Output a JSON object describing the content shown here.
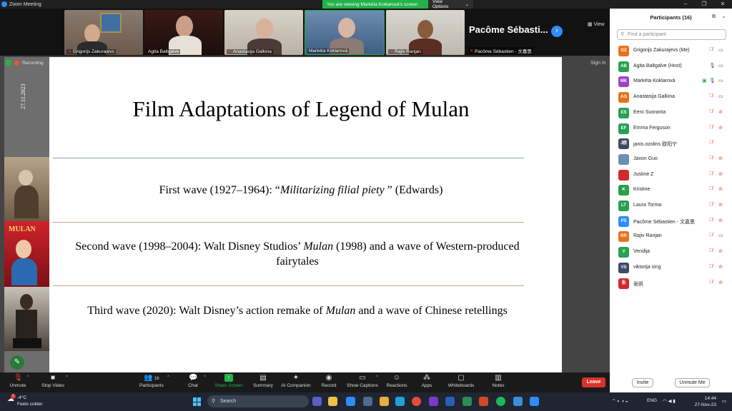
{
  "window": {
    "title": "Zoom Meeting",
    "controls": [
      "–",
      "❐",
      "✕"
    ]
  },
  "banner": {
    "viewing": "You are viewing Markéta Koklarová's screen",
    "view_options": "View Options",
    "chevron": "⌄"
  },
  "strip": {
    "tiles": [
      {
        "name": "Grigorijs Zakurajevs"
      },
      {
        "name": "Agita Baltgalve"
      },
      {
        "name": "Anastasija Galkina"
      },
      {
        "name": "Markéta Koklarová"
      },
      {
        "name": "Rajiv Ranjan"
      },
      {
        "name": "Pacôme Sébastien - 文嘉思"
      }
    ],
    "big_name": "Pacôme  Sébasti...",
    "view_label": "View",
    "next": "›"
  },
  "share": {
    "recording": "Recording",
    "sign_in": "Sign in",
    "slide": {
      "date": "27.11.2023",
      "poster_text": "MULAN",
      "title": "Film Adaptations of Legend of Mulan",
      "points": [
        {
          "pre": "First wave (1927–1964): “",
          "em": "Militarizing filial piety",
          "post": " ” (Edwards)"
        },
        {
          "pre": "Second wave (1998–2004): Walt Disney Studios’ ",
          "em": "Mulan",
          "post": " (1998) and a wave of Western-produced fairytales"
        },
        {
          "pre": "Third wave (2020): Walt Disney’s action remake of ",
          "em": "Mulan",
          "post": " and a wave of Chinese retellings"
        }
      ]
    }
  },
  "toolbar": {
    "unmute": "Unmute",
    "stop_video": "Stop Video",
    "participants": "Participants",
    "participants_count": "16",
    "chat": "Chat",
    "share_screen": "Share Screen",
    "summary": "Summary",
    "ai_companion": "AI Companion",
    "record": "Record",
    "show_captions": "Show Captions",
    "reactions": "Reactions",
    "apps": "Apps",
    "whiteboards": "Whiteboards",
    "notes": "Notes",
    "leave": "Leave"
  },
  "panel": {
    "title": "Participants (16)",
    "search_placeholder": "Find a participant",
    "participants": [
      {
        "initials": "GZ",
        "name": "Grigorijs Zakurajevs (Me)",
        "color": "#e8721c",
        "muted": true,
        "video_off": false
      },
      {
        "initials": "AB",
        "name": "Agita Baltgalve (Host)",
        "color": "#27a052",
        "muted": false,
        "video_off": false
      },
      {
        "initials": "MK",
        "name": "Markéta Koklarová",
        "color": "#9a43c6",
        "muted": false,
        "video_off": false,
        "sharing": true
      },
      {
        "initials": "AG",
        "name": "Anastasija Galkina",
        "color": "#e8721c",
        "muted": true,
        "video_off": false
      },
      {
        "initials": "ES",
        "name": "Eero Suoranta",
        "color": "#27a052",
        "muted": true,
        "video_off": true
      },
      {
        "initials": "EF",
        "name": "Emma Ferguson",
        "color": "#27a052",
        "muted": true,
        "video_off": true
      },
      {
        "initials": "J欧",
        "name": "janis.ozolins 欧阳宁",
        "color": "#3c4a63",
        "muted": true,
        "video_off": false,
        "no_video_icon": true
      },
      {
        "initials": "",
        "name": "Jaxon Guo",
        "color": "#6b8fb5",
        "muted": true,
        "video_off": true
      },
      {
        "initials": "",
        "name": "Justine Z",
        "color": "#d12a2a",
        "muted": true,
        "video_off": true
      },
      {
        "initials": "K",
        "name": "Kristine",
        "color": "#27a052",
        "muted": true,
        "video_off": true
      },
      {
        "initials": "LT",
        "name": "Laura Torma",
        "color": "#27a052",
        "muted": true,
        "video_off": true
      },
      {
        "initials": "PS",
        "name": "Pacôme Sébastien - 文嘉思",
        "color": "#2d8cff",
        "muted": true,
        "video_off": true
      },
      {
        "initials": "RR",
        "name": "Rajiv Ranjan",
        "color": "#e8721c",
        "muted": true,
        "video_off": false
      },
      {
        "initials": "V",
        "name": "Vendija",
        "color": "#27a052",
        "muted": true,
        "video_off": true
      },
      {
        "initials": "VS",
        "name": "viktorija sing",
        "color": "#3c4a63",
        "muted": true,
        "video_off": true
      },
      {
        "initials": "张",
        "name": "张凯",
        "color": "#d12a2a",
        "muted": true,
        "video_off": true
      }
    ],
    "invite": "Invite",
    "unmute_me": "Unmute Me"
  },
  "taskbar": {
    "weather_temp": "-4°C",
    "weather_desc": "Feels colder",
    "weather_badge": "1",
    "search": "Search",
    "lang": "ENG",
    "time": "14:44",
    "date": "27-Nov-23"
  }
}
